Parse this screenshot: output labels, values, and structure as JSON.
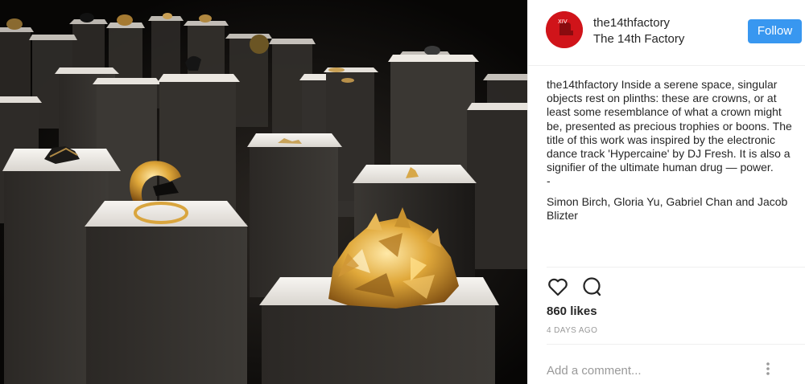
{
  "post": {
    "photo": {
      "description_icon": "exhibition-photo"
    },
    "header": {
      "username": "the14thfactory",
      "display_name": "The 14th Factory",
      "follow_label": "Follow",
      "avatar_icon": "brand-avatar-icon"
    },
    "caption": {
      "username": "the14thfactory",
      "text": " Inside a serene space, singular objects rest on plinths: these are crowns, or at least some resemblance of what a crown might be, presented as precious trophies or boons. The title of this work was inspired by the electronic dance track 'Hypercaine' by DJ Fresh. It is also a signifier of the ultimate human drug — power.",
      "dash": "-",
      "credits": "Simon Birch, Gloria Yu, Gabriel Chan and Jacob Blizter"
    },
    "actions": {
      "like_icon": "heart-icon",
      "comment_icon": "comment-bubble-icon"
    },
    "likes": "860 likes",
    "timestamp": "4 DAYS AGO",
    "comment_box": {
      "placeholder": "Add a comment...",
      "more_icon": "more-options-icon"
    },
    "colors": {
      "follow": "#3897f0",
      "avatar": "#d0141a",
      "divider": "#efefef",
      "meta_text": "#999999"
    }
  }
}
